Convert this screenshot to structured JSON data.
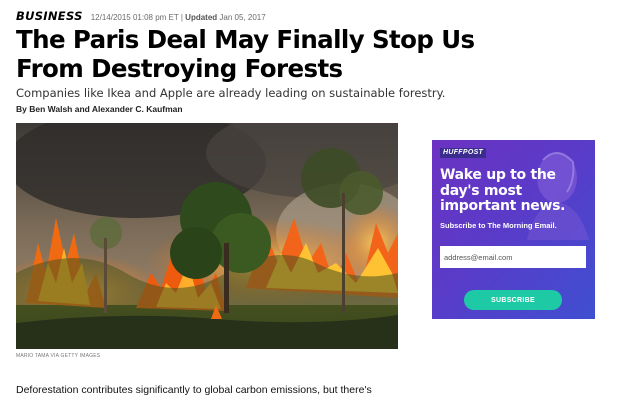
{
  "article": {
    "section": "BUSINESS",
    "published": "12/14/2015 01:08 pm ET",
    "updated_label": "Updated",
    "updated_date": "Jan 05, 2017",
    "headline": "The Paris Deal May Finally Stop Us From Destroying Forests",
    "subhead": "Companies like Ikea and Apple are already leading on sustainable forestry.",
    "byline": "By Ben Walsh and Alexander C. Kaufman",
    "image_credit": "MARIO TAMA VIA GETTY IMAGES",
    "body_first_line": "Deforestation contributes significantly to global carbon emissions, but there's some"
  },
  "newsletter_ad": {
    "logo": "HUFFPOST",
    "title": "Wake up to the day's most important news.",
    "subtitle": "Subscribe to The Morning Email.",
    "email_placeholder": "address@email.com",
    "button_label": "SUBSCRIBE",
    "colors": {
      "background_start": "#6c32c2",
      "background_end": "#3f4fd1",
      "button": "#1ecaa5"
    }
  }
}
